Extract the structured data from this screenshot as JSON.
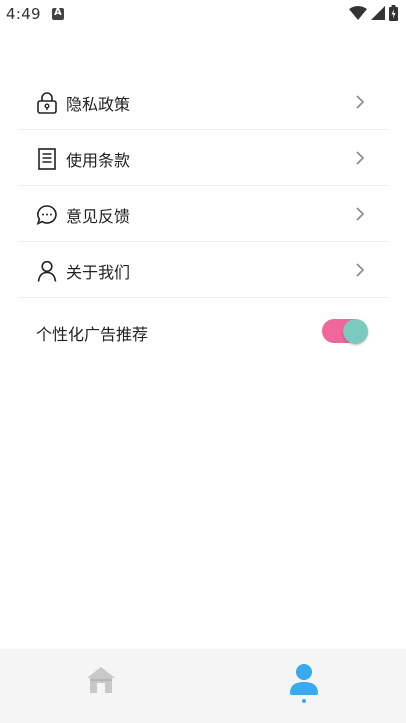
{
  "status_bar": {
    "time": "4:49",
    "notification_icon": "a-letter-icon",
    "icons": [
      "wifi-icon",
      "signal-icon",
      "battery-icon"
    ]
  },
  "menu": {
    "items": [
      {
        "label": "隐私政策",
        "icon": "lock-icon"
      },
      {
        "label": "使用条款",
        "icon": "document-icon"
      },
      {
        "label": "意见反馈",
        "icon": "chat-bubble-icon"
      },
      {
        "label": "关于我们",
        "icon": "person-icon"
      }
    ],
    "chevron_icon": "chevron-right-icon"
  },
  "personalized_ads": {
    "label": "个性化广告推荐",
    "enabled": true
  },
  "bottom_nav": {
    "items": [
      {
        "name": "home",
        "icon": "home-icon",
        "active": false
      },
      {
        "name": "profile",
        "icon": "user-icon",
        "active": true
      }
    ]
  },
  "colors": {
    "toggle_track": "#f0679b",
    "toggle_knob": "#7cc9bf",
    "active_nav": "#39a9f0",
    "inactive_nav": "#c8c8c8"
  }
}
